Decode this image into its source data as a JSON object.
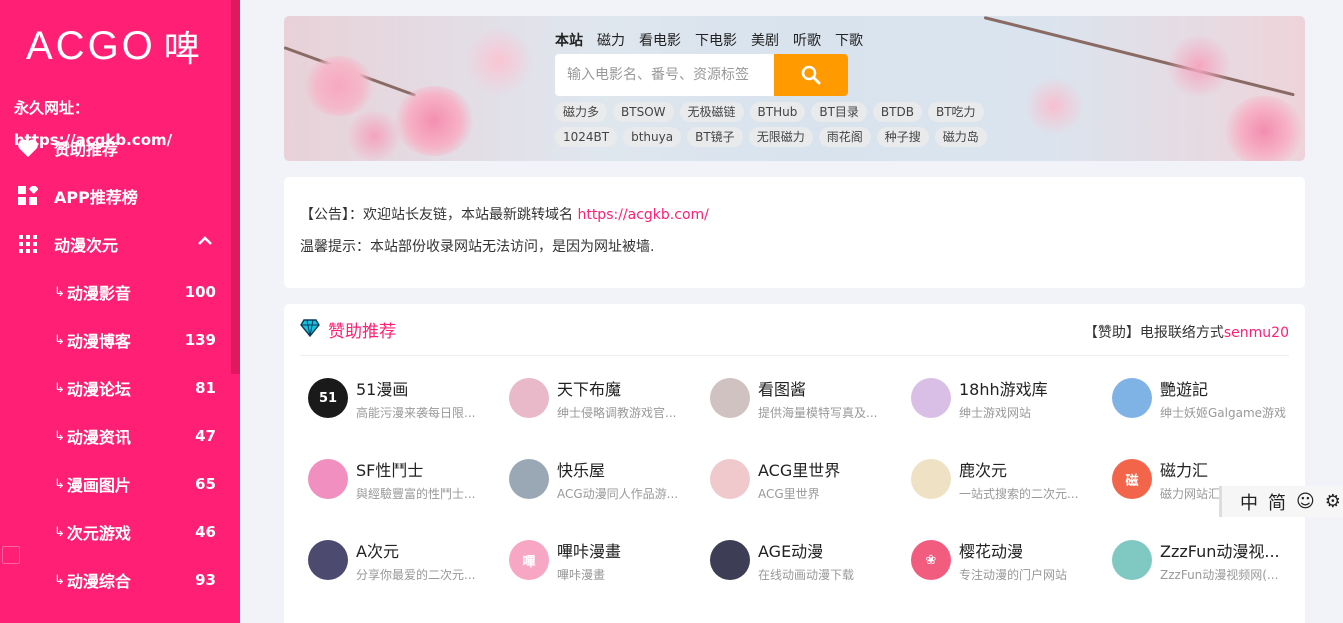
{
  "sidebar": {
    "logo_text": "ACGO",
    "logo_han": "啤",
    "permalink": "永久网址：https://acgkb.com/",
    "items": [
      {
        "label": "赞助推荐",
        "icon": "heart-icon"
      },
      {
        "label": "APP推荐榜",
        "icon": "apps-icon"
      },
      {
        "label": "动漫次元",
        "icon": "grid-icon"
      }
    ],
    "sub_items": [
      {
        "label": "动漫影音",
        "count": "100"
      },
      {
        "label": "动漫博客",
        "count": "139"
      },
      {
        "label": "动漫论坛",
        "count": "81"
      },
      {
        "label": "动漫资讯",
        "count": "47"
      },
      {
        "label": "漫画图片",
        "count": "65"
      },
      {
        "label": "次元游戏",
        "count": "46"
      },
      {
        "label": "动漫综合",
        "count": "93"
      }
    ],
    "sub_prefix": "↳"
  },
  "banner": {
    "tabs": [
      "本站",
      "磁力",
      "看电影",
      "下电影",
      "美剧",
      "听歌",
      "下歌"
    ],
    "active_tab": "本站",
    "search_placeholder": "输入电影名、番号、资源标签",
    "chips": [
      "磁力多",
      "BTSOW",
      "无极磁链",
      "BTHub",
      "BT目录",
      "BTDB",
      "BT吃力",
      "1024BT",
      "bthuya",
      "BT镜子",
      "无限磁力",
      "雨花阁",
      "种子搜",
      "磁力岛"
    ]
  },
  "notice": {
    "line1_prefix": "【公告】：欢迎站长友链，本站最新跳转域名 ",
    "line1_link": "https://acgkb.com/",
    "line2": "温馨提示：本站部份收录网站无法访问，是因为网址被墙."
  },
  "recommend": {
    "title": "赞助推荐",
    "right_prefix": "【赞助】电报联络方式",
    "right_contact": "senmu20",
    "sites": [
      {
        "name": "51漫画",
        "desc": "高能污漫来袭每日限...",
        "avatar": "51",
        "color": "#1a1a1a"
      },
      {
        "name": "天下布魔",
        "desc": "绅士侵略调教游戏官...",
        "avatar": "",
        "color": "#e9b8c9"
      },
      {
        "name": "看图酱",
        "desc": "提供海量模特写真及...",
        "avatar": "",
        "color": "#cfc2c0"
      },
      {
        "name": "18hh游戏库",
        "desc": "绅士游戏网站",
        "avatar": "",
        "color": "#d9bfe6"
      },
      {
        "name": "艷遊記",
        "desc": "绅士妖姬Galgame游戏",
        "avatar": "",
        "color": "#7fb3e6"
      },
      {
        "name": "SF性鬥士",
        "desc": "與經驗豐富的性鬥士...",
        "avatar": "",
        "color": "#f08fc0"
      },
      {
        "name": "快乐屋",
        "desc": "ACG动漫同人作品游...",
        "avatar": "",
        "color": "#9aa7b5"
      },
      {
        "name": "ACG里世界",
        "desc": "ACG里世界",
        "avatar": "",
        "color": "#f0c9cc"
      },
      {
        "name": "鹿次元",
        "desc": "一站式搜索的二次元...",
        "avatar": "",
        "color": "#efe1c4"
      },
      {
        "name": "磁力汇",
        "desc": "磁力网站汇",
        "avatar": "磁",
        "color": "#f2654a"
      },
      {
        "name": "A次元",
        "desc": "分享你最爱的二次元...",
        "avatar": "",
        "color": "#4c4a6e"
      },
      {
        "name": "嗶咔漫畫",
        "desc": "嗶咔漫畫",
        "avatar": "嗶",
        "color": "#f7a6c4"
      },
      {
        "name": "AGE动漫",
        "desc": "在线动画动漫下载",
        "avatar": "",
        "color": "#3d3d55"
      },
      {
        "name": "樱花动漫",
        "desc": "专注动漫的门户网站",
        "avatar": "❀",
        "color": "#f25c7f"
      },
      {
        "name": "ZzzFun动漫视...",
        "desc": "ZzzFun动漫视频网(...",
        "avatar": "",
        "color": "#7fc9c2"
      }
    ]
  },
  "lang_widget": [
    "中",
    "简",
    "☺",
    "⚙"
  ]
}
